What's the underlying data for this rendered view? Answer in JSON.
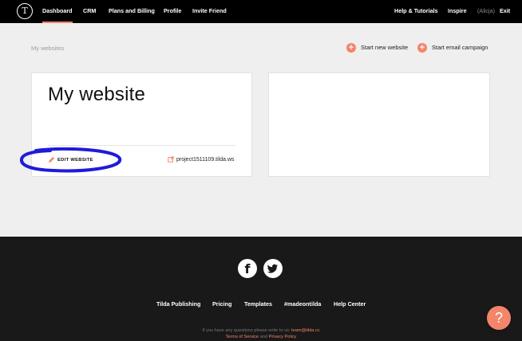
{
  "navbar": {
    "logo_glyph": "T",
    "items": [
      {
        "label": "Dashboard"
      },
      {
        "label": "CRM"
      },
      {
        "label": "Plans and Billing"
      },
      {
        "label": "Profile"
      },
      {
        "label": "Invite Friend"
      }
    ],
    "right": {
      "help": "Help & Tutorials",
      "inspire": "Inspire",
      "user": "(Alicja)",
      "exit": "Exit"
    },
    "accent_color": "#f4846a"
  },
  "main": {
    "breadcrumb": "My websites",
    "actions": {
      "new_website": "Start new website",
      "email_campaign": "Start email campaign"
    },
    "card": {
      "title": "My website",
      "edit_label": "EDIT WEBSITE",
      "site_url": "project1511109.tilda.ws"
    }
  },
  "footer": {
    "links": [
      "Tilda Publishing",
      "Pricing",
      "Templates",
      "#madeontilda",
      "Help Center"
    ],
    "contact_text": "If you have any questions please write to us:",
    "contact_email": "team@tilda.cc",
    "terms": "Terms of Service",
    "and": "and",
    "privacy": "Privacy Policy",
    "help_glyph": "?"
  }
}
